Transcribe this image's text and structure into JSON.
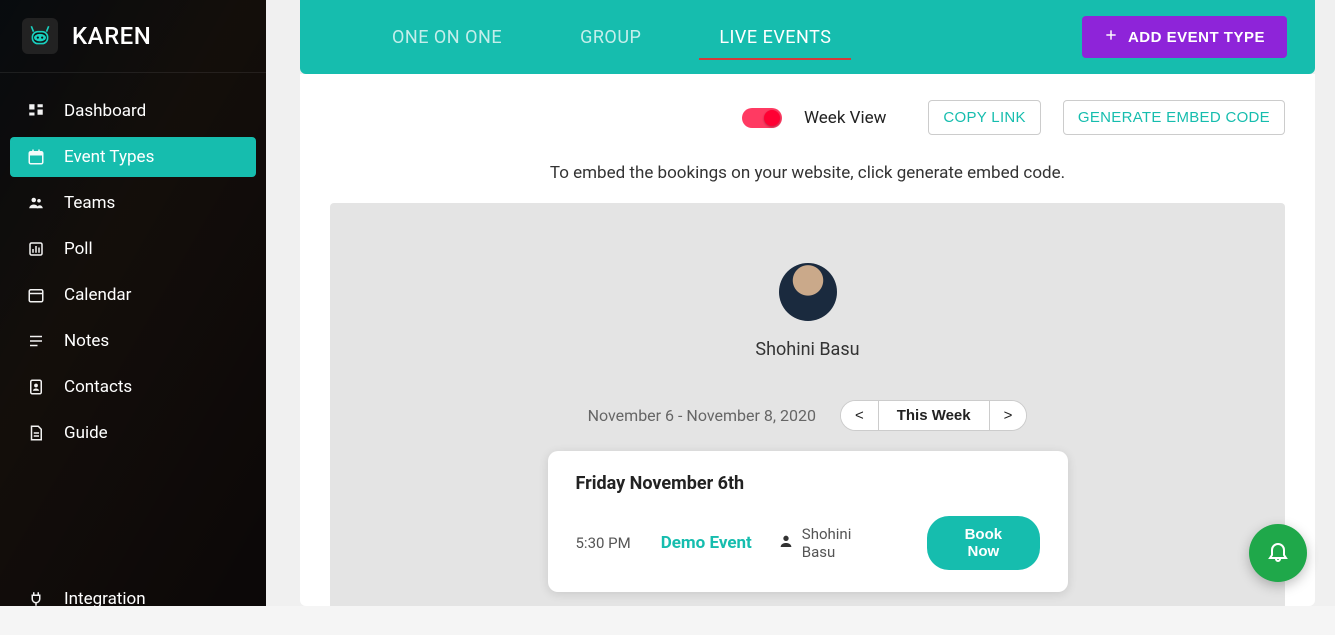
{
  "brand": {
    "name": "KAREN"
  },
  "sidebar": {
    "items": [
      {
        "label": "Dashboard"
      },
      {
        "label": "Event Types"
      },
      {
        "label": "Teams"
      },
      {
        "label": "Poll"
      },
      {
        "label": "Calendar"
      },
      {
        "label": "Notes"
      },
      {
        "label": "Contacts"
      },
      {
        "label": "Guide"
      }
    ],
    "bottom": {
      "label": "Integration"
    }
  },
  "tabs": {
    "one_on_one": "ONE ON ONE",
    "group": "GROUP",
    "live_events": "LIVE EVENTS"
  },
  "add_event_label": "ADD EVENT TYPE",
  "toolbar": {
    "week_view_label": "Week View",
    "copy_link": "COPY LINK",
    "generate_embed": "GENERATE EMBED CODE"
  },
  "embed_hint": "To embed the bookings on your website, click generate embed code.",
  "booking": {
    "host_name": "Shohini Basu",
    "date_range": "November 6 - November 8, 2020",
    "prev": "<",
    "this_week": "This Week",
    "next": ">",
    "card": {
      "date": "Friday November 6th",
      "time": "5:30 PM",
      "title": "Demo Event",
      "host": "Shohini Basu",
      "book": "Book Now"
    }
  }
}
